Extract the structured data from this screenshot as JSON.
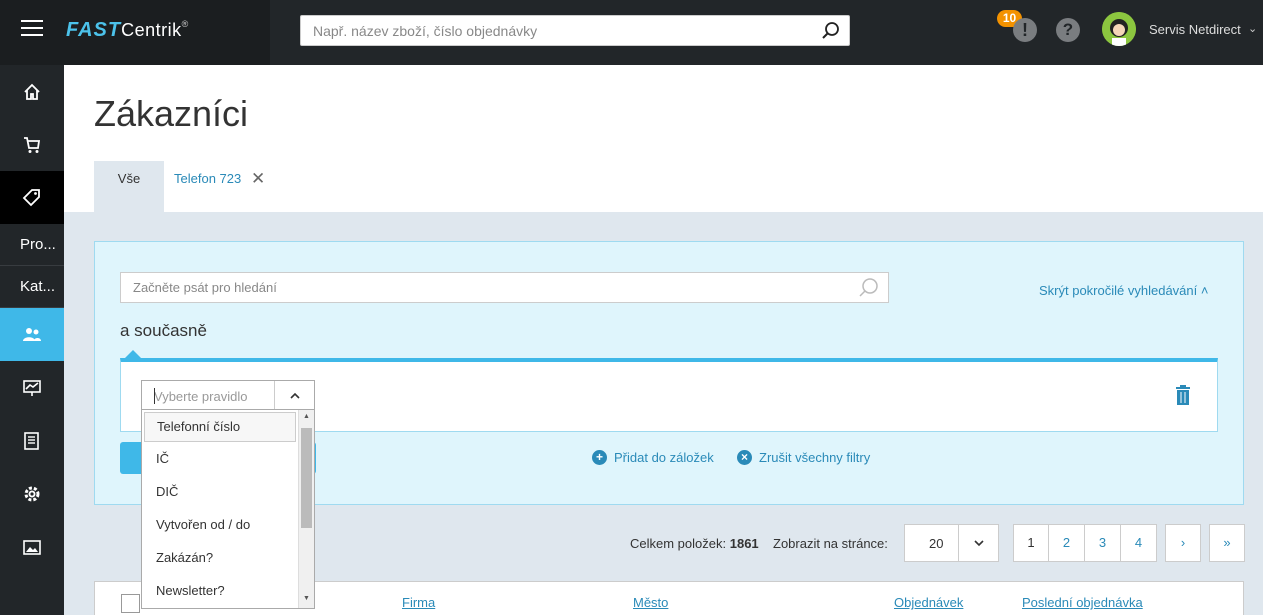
{
  "topbar": {
    "logo_fast": "FAST",
    "logo_centrik": "Centrik",
    "logo_reg": "®",
    "search_placeholder": "Např. název zboží, číslo objednávky",
    "notif_count": "10",
    "notif_symbol": "!",
    "help_symbol": "?",
    "user_name": "Servis Netdirect",
    "user_chevron": "⌄"
  },
  "sidebar": {
    "items": [
      {
        "icon": "home-icon"
      },
      {
        "icon": "cart-icon"
      },
      {
        "icon": "tag-icon"
      },
      {
        "label": "Pro..."
      },
      {
        "label": "Kat..."
      },
      {
        "icon": "users-icon"
      },
      {
        "icon": "chart-icon"
      },
      {
        "icon": "document-icon"
      },
      {
        "icon": "gear-icon"
      },
      {
        "icon": "image-icon"
      }
    ]
  },
  "page": {
    "title": "Zákazníci",
    "tabs": {
      "all": "Vše",
      "saved": "Telefon 723",
      "close": "✕"
    }
  },
  "filter": {
    "search_placeholder": "Začněte psát pro hledání",
    "hide_advanced": "Skrýt pokročilé vyhledávání ˄",
    "and_label": "a současně",
    "rule_placeholder": "Vyberte pravidlo",
    "add_bookmark": "Přidat do záložek",
    "clear_filters": "Zrušit všechny filtry",
    "plus_symbol": "+",
    "x_symbol": "×"
  },
  "dropdown": {
    "options": [
      "Telefonní číslo",
      "IČ",
      "DIČ",
      "Vytvořen od / do",
      "Zakázán?",
      "Newsletter?"
    ]
  },
  "listing": {
    "total_label": "Celkem položek:",
    "total_value": "1861",
    "per_page_label": "Zobrazit na stránce:",
    "per_page_value": "20",
    "pages": [
      "1",
      "2",
      "3",
      "4"
    ],
    "next": "›",
    "last": "»"
  },
  "table": {
    "columns": [
      "Firma",
      "Město",
      "Objednávek",
      "Poslední objednávka"
    ]
  },
  "colors": {
    "accent": "#3fb8e8",
    "link": "#2a8ab8",
    "badge": "#f39200"
  }
}
